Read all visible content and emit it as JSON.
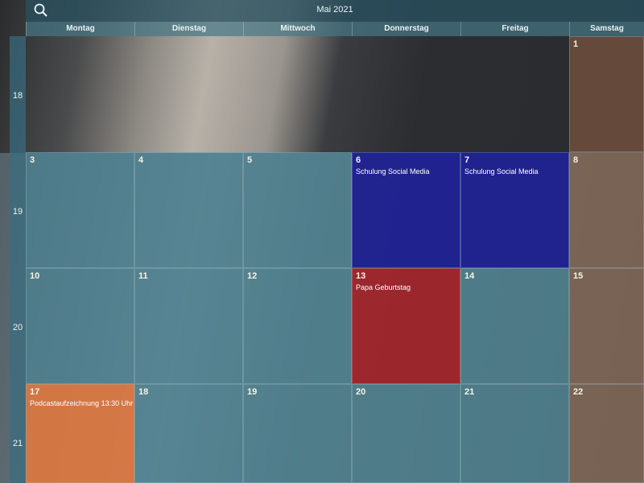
{
  "header": {
    "month_title": "Mai 2021",
    "icons": {
      "search": "search-icon"
    }
  },
  "day_names": [
    "Montag",
    "Dienstag",
    "Mittwoch",
    "Donnerstag",
    "Freitag",
    "Samstag"
  ],
  "weeks": [
    {
      "number": "18",
      "days": [
        "",
        "",
        "",
        "",
        "",
        "1"
      ]
    },
    {
      "number": "19",
      "days": [
        "3",
        "4",
        "5",
        "6",
        "7",
        "8"
      ],
      "events": {
        "6": "Schulung Social Media",
        "7": "Schulung Social Media"
      }
    },
    {
      "number": "20",
      "days": [
        "10",
        "11",
        "12",
        "13",
        "14",
        "15"
      ],
      "events": {
        "13": "Papa Geburtstag"
      }
    },
    {
      "number": "21",
      "days": [
        "17",
        "18",
        "19",
        "20",
        "21",
        "22"
      ],
      "events": {
        "17": "Podcastaufzeichnung 13:30 Uhr"
      }
    }
  ],
  "colors": {
    "event_blue": "#14149a",
    "event_red": "#aa191e",
    "event_orange": "#e6783c"
  }
}
